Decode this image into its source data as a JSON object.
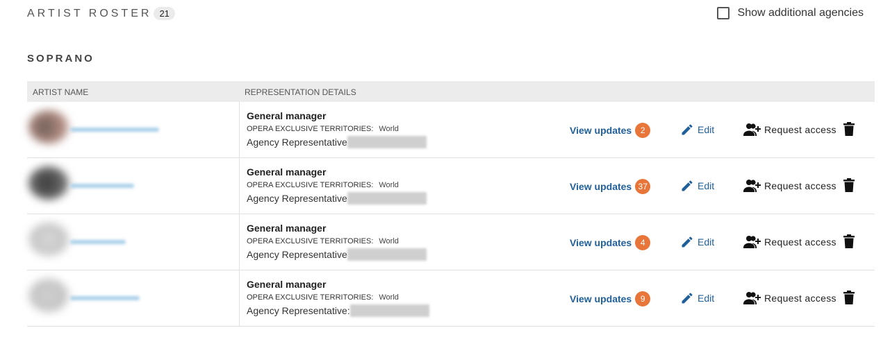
{
  "header": {
    "title": "ARTIST ROSTER",
    "count": "21",
    "toggle_label": "Show additional agencies"
  },
  "section": {
    "title": "SOPRANO"
  },
  "table": {
    "columns": {
      "artist": "ARTIST NAME",
      "representation": "REPRESENTATION DETAILS"
    },
    "rows": [
      {
        "role": "General manager",
        "territory_label": "OPERA EXCLUSIVE TERRITORIES:",
        "territory_value": "World",
        "agency_label": "Agency Representative",
        "updates_label": "View updates",
        "updates_count": "2",
        "edit_label": "Edit",
        "request_label": "Request access"
      },
      {
        "role": "General manager",
        "territory_label": "OPERA EXCLUSIVE TERRITORIES:",
        "territory_value": "World",
        "agency_label": "Agency Representative",
        "updates_label": "View updates",
        "updates_count": "37",
        "edit_label": "Edit",
        "request_label": "Request access"
      },
      {
        "role": "General manager",
        "territory_label": "OPERA EXCLUSIVE TERRITORIES:",
        "territory_value": "World",
        "agency_label": "Agency Representative",
        "updates_label": "View updates",
        "updates_count": "4",
        "edit_label": "Edit",
        "request_label": "Request access"
      },
      {
        "role": "General manager",
        "territory_label": "OPERA EXCLUSIVE TERRITORIES:",
        "territory_value": "World",
        "agency_label": "Agency Representative:",
        "updates_label": "View updates",
        "updates_count": "9",
        "edit_label": "Edit",
        "request_label": "Request access"
      }
    ]
  },
  "icons": {
    "edit": "pencil-icon",
    "request": "person-add-icon",
    "delete": "trash-icon"
  },
  "colors": {
    "link": "#1f5f9a",
    "badge": "#e8763a",
    "header_bg": "#ececec"
  }
}
